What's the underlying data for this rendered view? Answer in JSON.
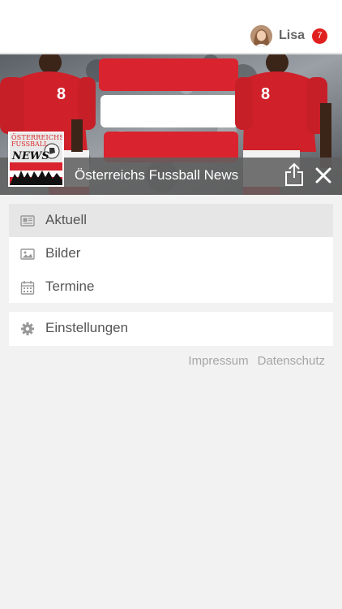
{
  "user": {
    "name": "Lisa",
    "notification_count": "7"
  },
  "app": {
    "title": "Österreichs Fussball News",
    "logo_text_line1": "ÖSTERREICHS",
    "logo_text_line2": "FUSSBALL",
    "logo_text_line3": "NEWS"
  },
  "menu": {
    "main_items": [
      {
        "label": "Aktuell",
        "icon": "newspaper-icon",
        "active": true
      },
      {
        "label": "Bilder",
        "icon": "image-icon",
        "active": false
      },
      {
        "label": "Termine",
        "icon": "calendar-icon",
        "active": false
      }
    ],
    "settings_item": {
      "label": "Einstellungen",
      "icon": "gear-icon"
    }
  },
  "footer": {
    "impressum": "Impressum",
    "datenschutz": "Datenschutz"
  },
  "colors": {
    "badge": "#e02020",
    "overlay_bar": "#606060",
    "active_item_bg": "#e6e6e6",
    "flag_red": "#d9232e",
    "flag_white": "#ffffff"
  }
}
